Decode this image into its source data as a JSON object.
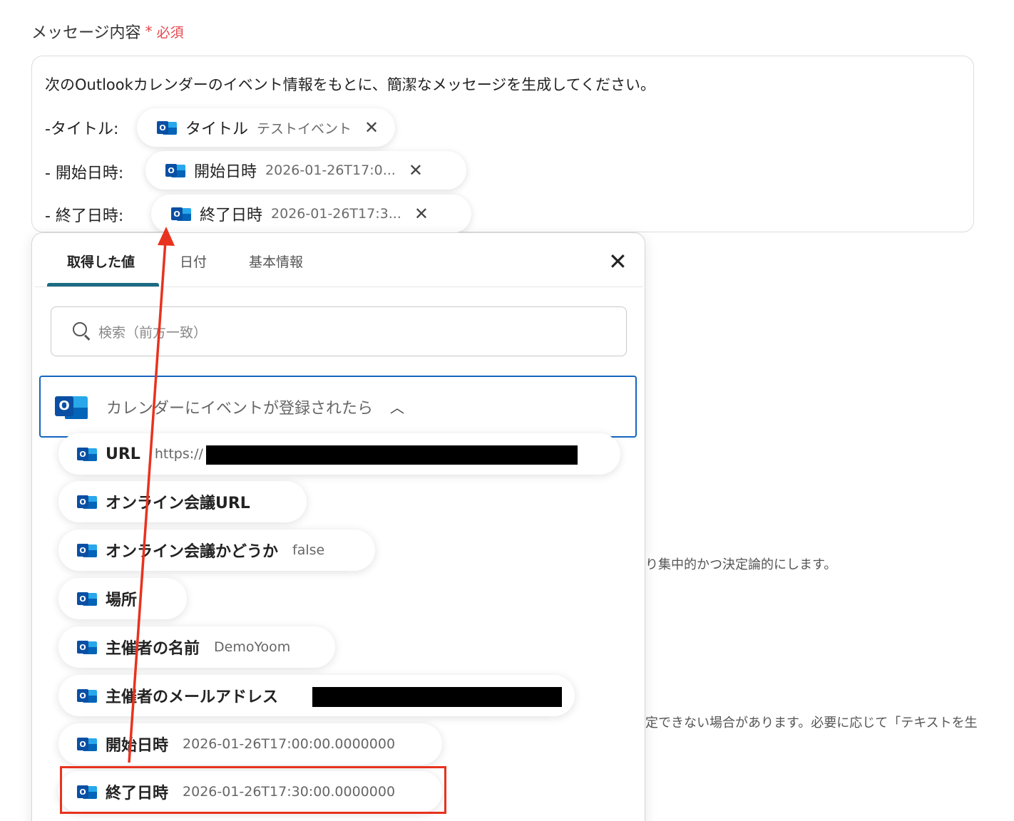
{
  "field": {
    "label": "メッセージ内容",
    "required_mark": "*",
    "required_text": "必須"
  },
  "message": {
    "line1": "次のOutlookカレンダーのイベント情報をもとに、簡潔なメッセージを生成してください。",
    "rows": [
      {
        "label": "-タイトル:",
        "pill_label": "タイトル",
        "pill_value": "テストイベント"
      },
      {
        "label": "- 開始日時:",
        "pill_label": "開始日時",
        "pill_value": "2026-01-26T17:0..."
      },
      {
        "label": "- 終了日時:",
        "pill_label": "終了日時",
        "pill_value": "2026-01-26T17:3..."
      }
    ],
    "close_glyph": "✕"
  },
  "background_text": {
    "line1": "り集中的かつ決定論的にします。",
    "line2": "定できない場合があります。必要に応じて「テキストを生"
  },
  "dropdown": {
    "tabs": [
      {
        "label": "取得した値",
        "active": true
      },
      {
        "label": "日付",
        "active": false
      },
      {
        "label": "基本情報",
        "active": false
      }
    ],
    "close_glyph": "✕",
    "search_placeholder": "検索（前方一致）",
    "group": {
      "title": "カレンダーにイベントが登録されたら",
      "chevron": "︿"
    },
    "items": [
      {
        "label": "URL",
        "value": "https://"
      },
      {
        "label": "オンライン会議URL",
        "value": ""
      },
      {
        "label": "オンライン会議かどうか",
        "value": "false"
      },
      {
        "label": "場所",
        "value": ""
      },
      {
        "label": "主催者の名前",
        "value": "DemoYoom"
      },
      {
        "label": "主催者のメールアドレス",
        "value": ""
      },
      {
        "label": "開始日時",
        "value": "2026-01-26T17:00:00.0000000"
      },
      {
        "label": "終了日時",
        "value": "2026-01-26T17:30:00.0000000"
      }
    ]
  },
  "icons": {
    "outlook": "outlook-icon",
    "close": "close-icon",
    "search": "search-icon",
    "chevron": "chevron-up-icon"
  },
  "colors": {
    "required": "#e5484d",
    "tab_underline": "#1b6b82",
    "group_border": "#1565c0",
    "annotation": "#e8321e"
  }
}
